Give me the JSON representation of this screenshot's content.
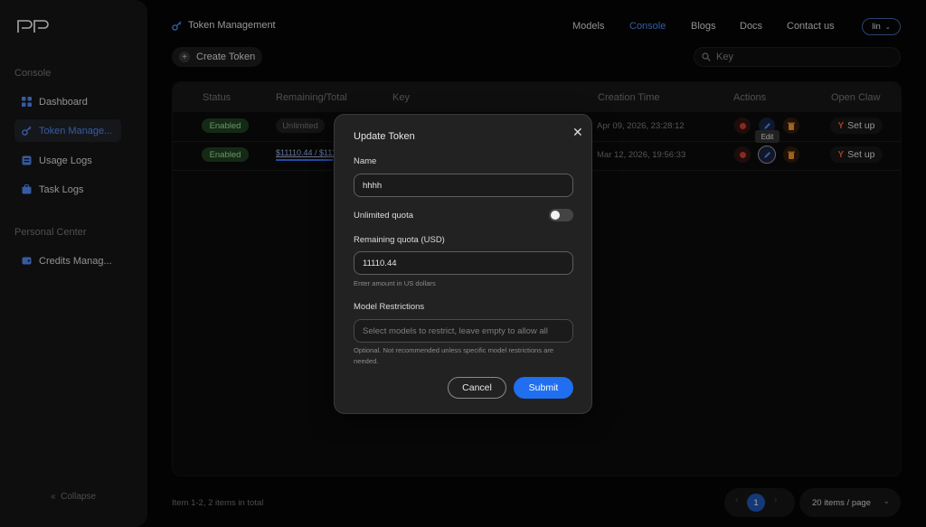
{
  "sidebar": {
    "sections": [
      {
        "title": "Console",
        "items": [
          {
            "label": "Dashboard",
            "icon": "grid-icon"
          },
          {
            "label": "Token Manage...",
            "icon": "key-icon",
            "active": true
          },
          {
            "label": "Usage Logs",
            "icon": "database-icon"
          },
          {
            "label": "Task Logs",
            "icon": "briefcase-icon"
          }
        ]
      },
      {
        "title": "Personal Center",
        "items": [
          {
            "label": "Credits Manag...",
            "icon": "wallet-icon"
          }
        ]
      }
    ],
    "collapse_label": "Collapse"
  },
  "header": {
    "page_title": "Token Management",
    "nav": [
      "Models",
      "Console",
      "Blogs",
      "Docs",
      "Contact us"
    ],
    "active_nav": "Console",
    "user": "lin"
  },
  "toolbar": {
    "create_label": "Create Token",
    "search_placeholder": "Key"
  },
  "table": {
    "columns": [
      "Status",
      "Remaining/Total",
      "Key",
      "Creation Time",
      "Actions",
      "Open Claw"
    ],
    "rows": [
      {
        "status": "Enabled",
        "quota": "Unlimited",
        "created": "Apr 09, 2026, 23:28:12",
        "setup": "Set up"
      },
      {
        "status": "Enabled",
        "quota": "$11110.44 / $11176",
        "quota_fraction": 0.994,
        "created": "Mar 12, 2026, 19:56:33",
        "setup": "Set up"
      }
    ],
    "tooltip": "Edit"
  },
  "footer": {
    "info": "Item 1-2, 2 items in total",
    "current_page": "1",
    "per_page": "20 items / page"
  },
  "modal": {
    "title": "Update Token",
    "name_label": "Name",
    "name_value": "hhhh",
    "unlimited_label": "Unlimited quota",
    "unlimited_on": false,
    "quota_label": "Remaining quota (USD)",
    "quota_value": "11110.44",
    "quota_help": "Enter amount in US dollars",
    "restrict_label": "Model Restrictions",
    "restrict_placeholder": "Select models to restrict, leave empty to allow all",
    "restrict_help": "Optional. Not recommended unless specific model restrictions are needed.",
    "cancel_label": "Cancel",
    "submit_label": "Submit"
  },
  "colors": {
    "accent": "#1f6ff0",
    "active_nav": "#4b7fe0",
    "enabled_badge": "#1d3b1f",
    "setup_y": "#e8542c"
  }
}
